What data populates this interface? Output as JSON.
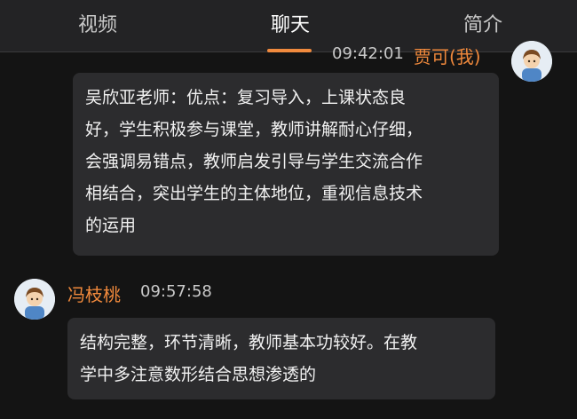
{
  "tabs": [
    {
      "label": "视频"
    },
    {
      "label": "聊天"
    },
    {
      "label": "简介"
    }
  ],
  "active_tab": "聊天",
  "messages": [
    {
      "sender": "贾可(我)",
      "time": "09:42:01",
      "lines": [
        "吴欣亚老师：优点：复习导入，上课状态良",
        "好，学生积极参与课堂，教师讲解耐心仔细，",
        "会强调易错点，教师启发引导与学生交流合作",
        "相结合，突出学生的主体地位，重视信息技术",
        "的运用"
      ]
    },
    {
      "sender": "冯枝桃",
      "time": "09:57:58",
      "lines": [
        "结构完整，环节清晰，教师基本功较好。在教",
        "学中多注意数形结合思想渗透的"
      ]
    }
  ],
  "colors": {
    "accent": "#f08a3e",
    "background": "#141414",
    "tabbar": "#232325",
    "bubble": "#2c2c2e"
  },
  "icons": {
    "avatar": "user-avatar-icon"
  }
}
